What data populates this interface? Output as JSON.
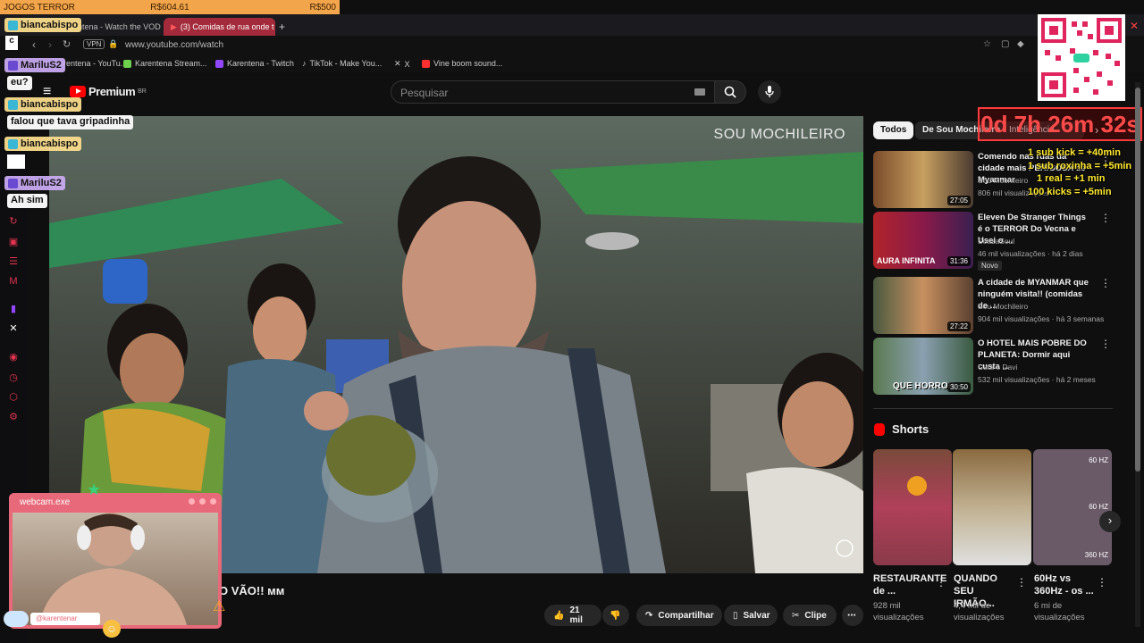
{
  "stream_bar": {
    "left": "JOGOS TERROR",
    "mid": "R$604.61",
    "right": "R$500"
  },
  "tabs": [
    {
      "label": "Karentena - Watch the VOD"
    },
    {
      "label": "(3) Comidas de rua onde t"
    }
  ],
  "url": "www.youtube.com/watch",
  "vpn": "VPN",
  "bookmarks": [
    {
      "label": "Karentena - YouTu...",
      "color": "#ff3030"
    },
    {
      "label": "Karentena Stream...",
      "color": "#6fd04f"
    },
    {
      "label": "Karentena - Twitch",
      "color": "#9146ff"
    },
    {
      "label": "TikTok - Make You...",
      "color": "#ffffff"
    },
    {
      "label": "X",
      "color": "#ffffff"
    },
    {
      "label": "Vine boom sound...",
      "color": "#ff3030"
    }
  ],
  "yt": {
    "logo": "Premium",
    "region": "BR",
    "search_placeholder": "Pesquisar"
  },
  "video": {
    "overlay_brand": "SOU MOCHILEIRO",
    "title": "O VÃO!! мм"
  },
  "chips": [
    "Todos",
    "De Sou Mochileiro",
    "Inteligência"
  ],
  "recommendations": [
    {
      "title": "Comendo nas ruas da cidade mais PERIGOSA de Myanmar",
      "channel": "Sou Mochileiro",
      "meta": "806 mil visualizações",
      "duration": "27:05",
      "badge": ""
    },
    {
      "title": "Eleven De Stranger Things é o TERROR Do Vecna e Usei o ...",
      "channel": "SouzaSoul",
      "meta": "46 mil visualizações · há 2 dias",
      "duration": "31:36",
      "badge": "Novo",
      "thumb_text": "AURA INFINITA"
    },
    {
      "title": "A cidade de MYANMAR que ninguém visita!! (comidas de ...",
      "channel": "Sou Mochileiro",
      "meta": "904 mil visualizações · há 3 semanas",
      "duration": "27:22",
      "badge": ""
    },
    {
      "title": "O HOTEL MAIS POBRE DO PLANETA: Dormir aqui custa ...",
      "channel": "Cata e Davi",
      "meta": "532 mil visualizações · há 2 meses",
      "duration": "30:50",
      "badge": "",
      "thumb_text": "QUE HORROR"
    }
  ],
  "shorts_heading": "Shorts",
  "shorts": [
    {
      "title": "RESTAURANTE de ...",
      "meta": "928 mil visualizações"
    },
    {
      "title": "QUANDO SEU IRMÃO...",
      "meta": "4,4 mil de visualizações"
    },
    {
      "title": "60Hz vs 360Hz - os ...",
      "meta": "6 mi de visualizações",
      "labels": [
        "60 HZ",
        "60 HZ",
        "360 HZ"
      ]
    }
  ],
  "actions": {
    "likes": "21 mil",
    "share": "Compartilhar",
    "save": "Salvar",
    "clip": "Clipe"
  },
  "chat": [
    {
      "user": "biancabispo",
      "msg": ""
    },
    {
      "user": "MariluS2",
      "msg": "eu?"
    },
    {
      "user": "biancabispo",
      "msg": "falou que tava gripadinha"
    },
    {
      "user": "biancabispo",
      "msg": ""
    },
    {
      "user": "MariluS2",
      "msg": "Ah sim"
    }
  ],
  "timer": "0d 7h 26m 32s",
  "rules": [
    "1 sub kick = +40min",
    "1 sub roxinha = +5min",
    "1 real = +1 min",
    "100 kicks = +5min"
  ],
  "webcam": {
    "title": "webcam.exe",
    "handle": "@karentenar"
  },
  "colors": {
    "yt_red": "#ff0000",
    "accent_twitch": "#e2344f",
    "timer": "#ff4a4a"
  }
}
